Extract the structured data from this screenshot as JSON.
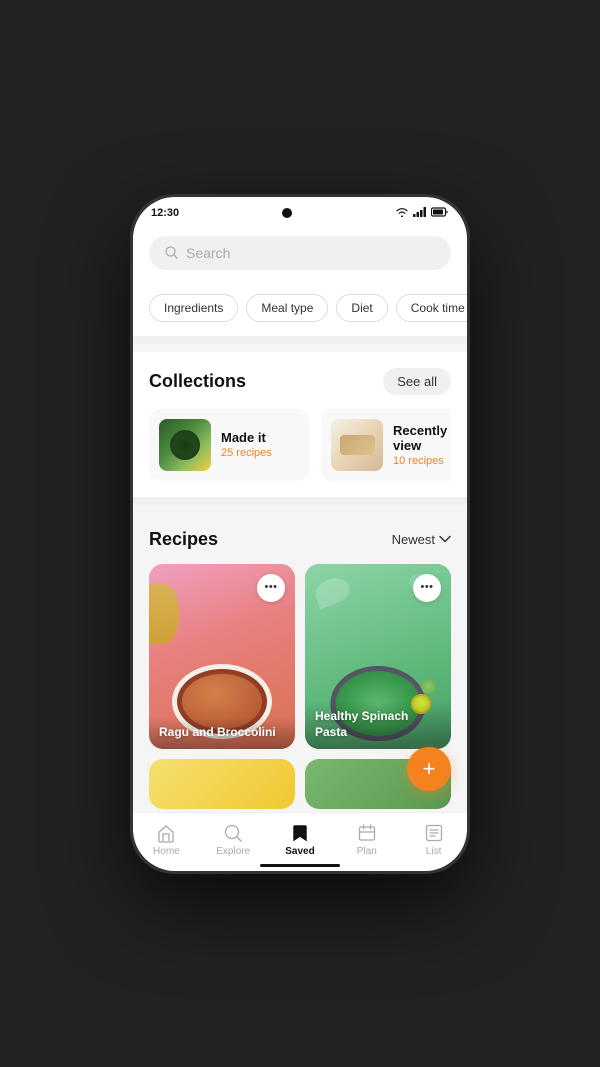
{
  "status": {
    "time": "12:30",
    "wifi": "📶",
    "signal": "📶",
    "battery": "🔋"
  },
  "search": {
    "placeholder": "Search"
  },
  "filters": [
    {
      "id": "ingredients",
      "label": "Ingredients"
    },
    {
      "id": "meal-type",
      "label": "Meal type"
    },
    {
      "id": "diet",
      "label": "Diet"
    },
    {
      "id": "cook-time",
      "label": "Cook time"
    }
  ],
  "collections": {
    "title": "Collections",
    "see_all": "See all",
    "items": [
      {
        "id": "made-it",
        "name": "Made it",
        "count": "25 recipes"
      },
      {
        "id": "recently-viewed",
        "name": "Recently view",
        "count": "10 recipes"
      }
    ]
  },
  "recipes": {
    "title": "Recipes",
    "sort_label": "Newest",
    "items": [
      {
        "id": "ragu",
        "name": "Ragu and Broccolini"
      },
      {
        "id": "spinach",
        "name": "Healthy Spinach Pasta"
      }
    ]
  },
  "fab": {
    "label": "+"
  },
  "nav": {
    "items": [
      {
        "id": "home",
        "label": "Home",
        "icon": "⌂",
        "active": false
      },
      {
        "id": "explore",
        "label": "Explore",
        "icon": "○",
        "active": false
      },
      {
        "id": "saved",
        "label": "Saved",
        "icon": "⬟",
        "active": true
      },
      {
        "id": "plan",
        "label": "Plan",
        "icon": "▭",
        "active": false
      },
      {
        "id": "list",
        "label": "List",
        "icon": "≡",
        "active": false
      }
    ]
  }
}
